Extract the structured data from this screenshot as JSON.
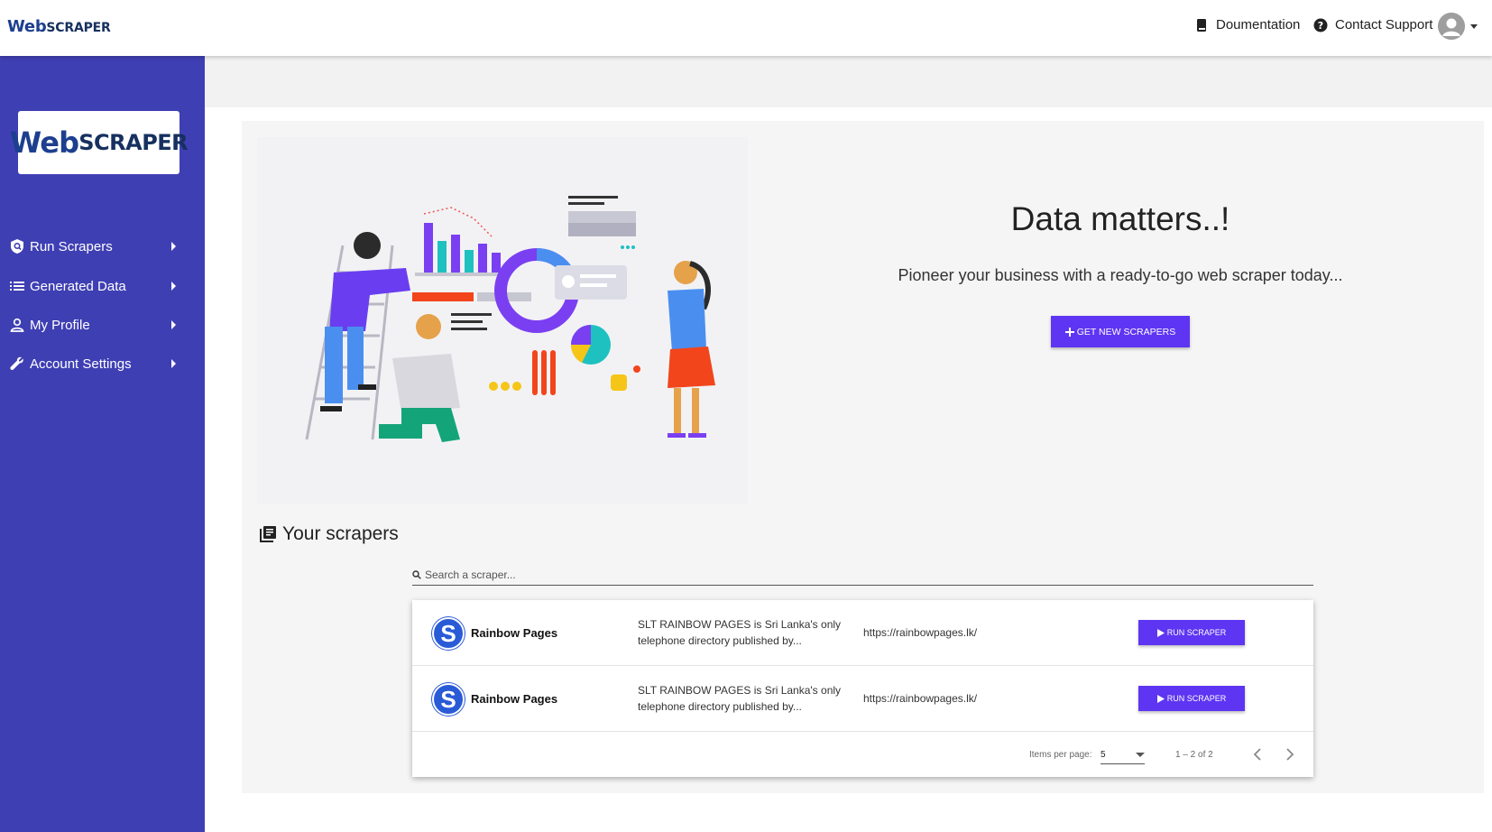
{
  "app": {
    "brand_big": "Web",
    "brand_small": "SCRAPER"
  },
  "topbar": {
    "documentation_label": "Doumentation",
    "contact_label": "Contact Support"
  },
  "sidebar": {
    "items": [
      {
        "label": "Run Scrapers",
        "icon": "shield-search-icon"
      },
      {
        "label": "Generated Data",
        "icon": "list-icon"
      },
      {
        "label": "My Profile",
        "icon": "person-icon"
      },
      {
        "label": "Account Settings",
        "icon": "wrench-icon"
      }
    ]
  },
  "hero": {
    "title": "Data matters..!",
    "subtitle": "Pioneer your business with a ready-to-go web scraper today...",
    "cta_label": "GET NEW SCRAPERS"
  },
  "scrapers": {
    "section_title": "Your scrapers",
    "search_placeholder": "Search a scraper...",
    "rows": [
      {
        "avatar_letter": "S",
        "name": "Rainbow Pages",
        "description": "SLT RAINBOW PAGES is Sri Lanka's only telephone directory published by...",
        "url": "https://rainbowpages.lk/",
        "action": "RUN SCRAPER"
      },
      {
        "avatar_letter": "S",
        "name": "Rainbow Pages",
        "description": "SLT RAINBOW PAGES is Sri Lanka's only telephone directory published by...",
        "url": "https://rainbowpages.lk/",
        "action": "RUN SCRAPER"
      }
    ],
    "paginator": {
      "items_per_page_label": "Items per page:",
      "items_per_page_value": "5",
      "range_label": "1 – 2 of 2"
    }
  },
  "colors": {
    "sidebar": "#3f3fb4",
    "primary_button": "#5e35f2",
    "avatar": "#2a5bd7"
  }
}
